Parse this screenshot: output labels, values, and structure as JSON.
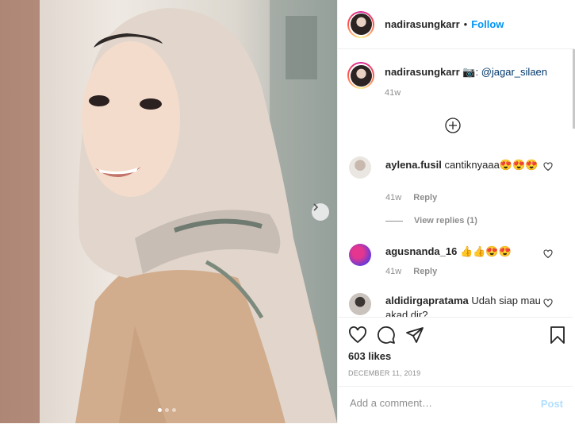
{
  "photo": {
    "description_icon": "photo",
    "next_icon": "chevron-right-icon",
    "dots_count": 3,
    "active_dot": 1
  },
  "header": {
    "username": "nadirasungkarr",
    "separator": "•",
    "follow_label": "Follow"
  },
  "caption": {
    "username": "nadirasungkarr",
    "text": "📷: ",
    "mention": "@jagar_silaen",
    "time": "41w"
  },
  "comments": [
    {
      "username": "aylena.fusil",
      "text": "cantiknyaaa😍😍😍",
      "time": "41w",
      "reply_label": "Reply",
      "view_replies": "View replies (1)"
    },
    {
      "username": "agusnanda_16",
      "text": "👍👍😍😍",
      "time": "41w",
      "reply_label": "Reply"
    },
    {
      "username": "aldidirgapratama",
      "text": "Udah siap mau akad dir?",
      "time": "",
      "reply_label": ""
    }
  ],
  "actions": {
    "like_icon": "heart-icon",
    "comment_icon": "comment-icon",
    "share_icon": "paper-plane-icon",
    "save_icon": "bookmark-icon",
    "likes": "603 likes",
    "date": "DECEMBER 11, 2019"
  },
  "add_comment": {
    "placeholder": "Add a comment…",
    "post_label": "Post"
  },
  "colors": {
    "accent": "#0095f6",
    "post_disabled": "#b2dffc",
    "muted": "#8e8e8e"
  }
}
